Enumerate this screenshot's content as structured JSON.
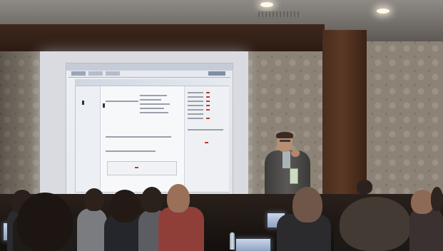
{
  "scene": {
    "subject": "presentation",
    "colors": {
      "wall": "#8c8376",
      "wood": "#4a2d1e",
      "projection": "#e6e9ef",
      "presenter_jacket": "#4a4947",
      "audience": "#1d1714"
    }
  }
}
